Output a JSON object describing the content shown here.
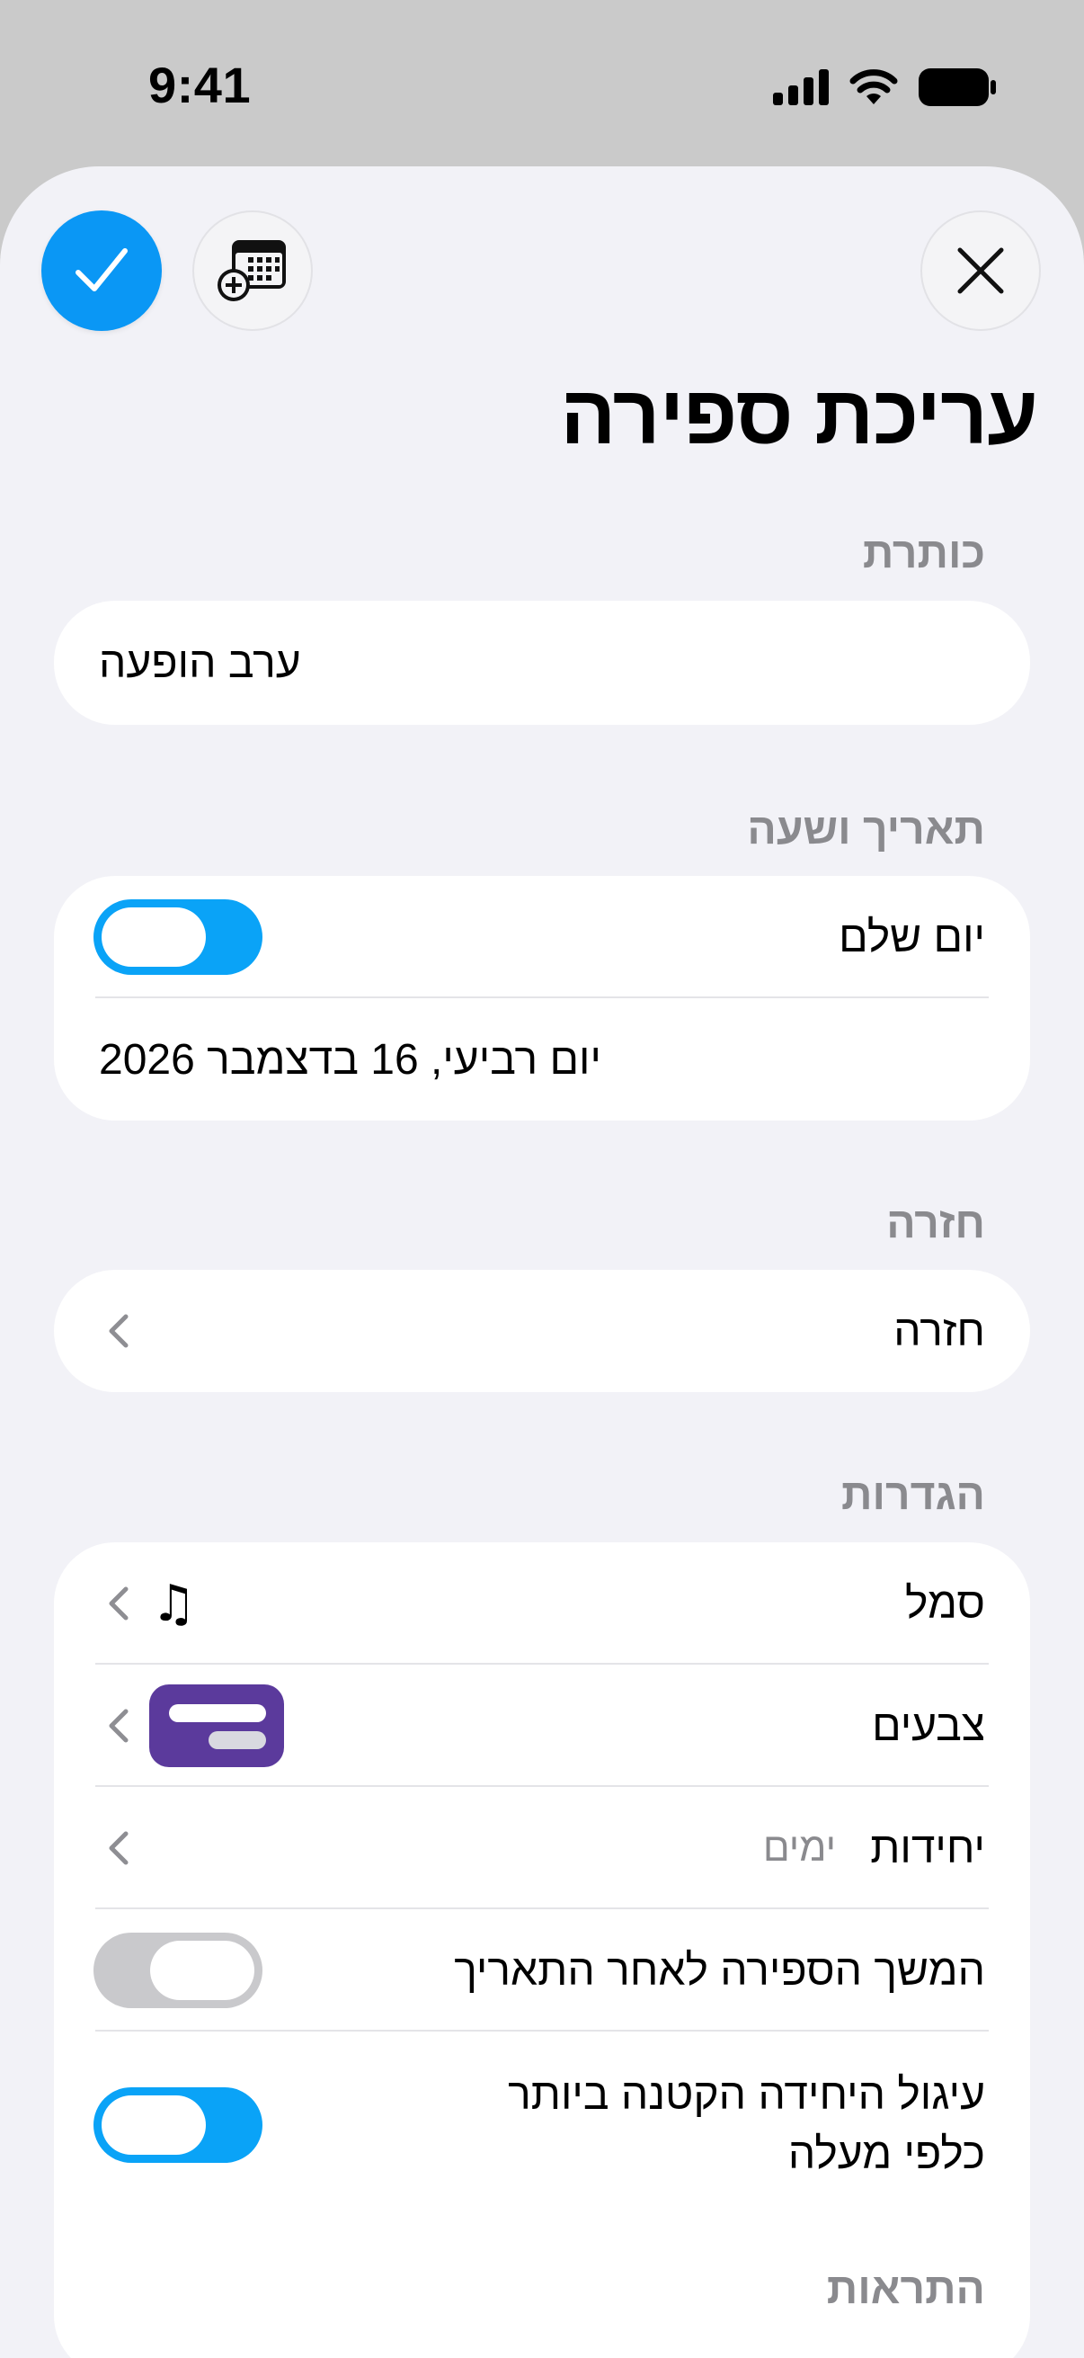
{
  "status": {
    "time": "9:41"
  },
  "header": {
    "title": "עריכת ספירה"
  },
  "title_section": {
    "header": "כותרת",
    "value": "ערב הופעה"
  },
  "date_section": {
    "header": "תאריך ושעה",
    "all_day_label": "יום שלם",
    "all_day_on": true,
    "date_value": "יום רביעי, 16 בדצמבר 2026"
  },
  "repeat_section": {
    "header": "חזרה",
    "row_label": "חזרה"
  },
  "settings_section": {
    "header": "הגדרות",
    "symbol_label": "סמל",
    "symbol_glyph": "♫",
    "colors_label": "צבעים",
    "color_swatch": "#5b3a9c",
    "units_label": "יחידות",
    "units_value": "ימים",
    "continue_label": "המשך הספירה לאחר התאריך",
    "continue_on": false,
    "round_label_line1": "עיגול היחידה הקטנה ביותר",
    "round_label_line2": "כלפי מעלה",
    "round_on": true
  },
  "alerts_section": {
    "header": "התראות"
  },
  "colors": {
    "accent": "#0a97f5",
    "toggle_on": "#0aa3f7",
    "toggle_off": "#c9c9cc"
  }
}
